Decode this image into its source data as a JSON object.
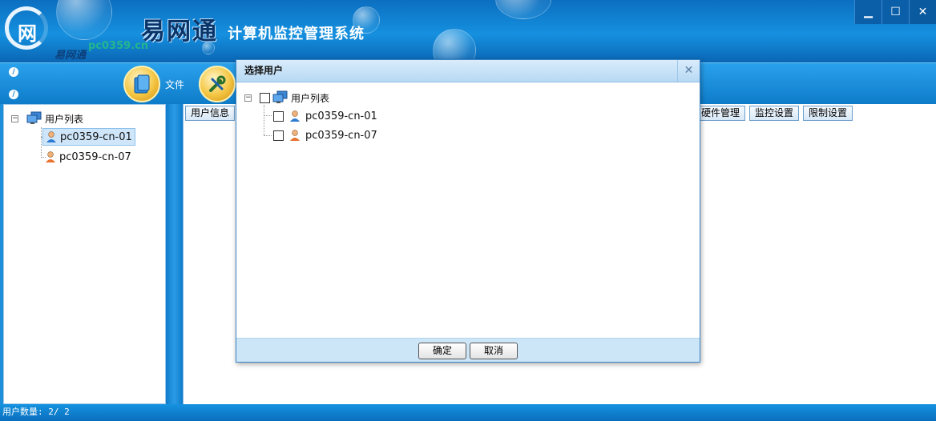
{
  "app": {
    "logo_mark": "网",
    "logo_sub": "易网通",
    "logo_site": "pc0359.cn",
    "brand_name": "易网通",
    "title": "计算机监控管理系统"
  },
  "window_controls": {
    "minimize": "▁",
    "maximize": "☐",
    "close": "✕"
  },
  "toolbar": {
    "file_label": "文件"
  },
  "tree": {
    "root_label": "用户列表",
    "items": [
      {
        "label": "pc0359-cn-01",
        "selected": true
      },
      {
        "label": "pc0359-cn-07",
        "selected": false
      }
    ]
  },
  "tabs": [
    "用户信息",
    "硬件管理",
    "监控设置",
    "限制设置"
  ],
  "status": {
    "text": "用户数量: 2/ 2"
  },
  "dialog": {
    "title": "选择用户",
    "close_glyph": "✕",
    "root_label": "用户列表",
    "items": [
      {
        "label": "pc0359-cn-01",
        "checked": false
      },
      {
        "label": "pc0359-cn-07",
        "checked": false
      }
    ],
    "ok_label": "确定",
    "cancel_label": "取消"
  },
  "icons": {
    "expander_glyph": "⊟",
    "tb_dot_glyph": "∕"
  },
  "colors": {
    "accent": "#1590df",
    "titlebar_dark": "#0a66b4",
    "dialog_footer": "#cde6f7"
  }
}
